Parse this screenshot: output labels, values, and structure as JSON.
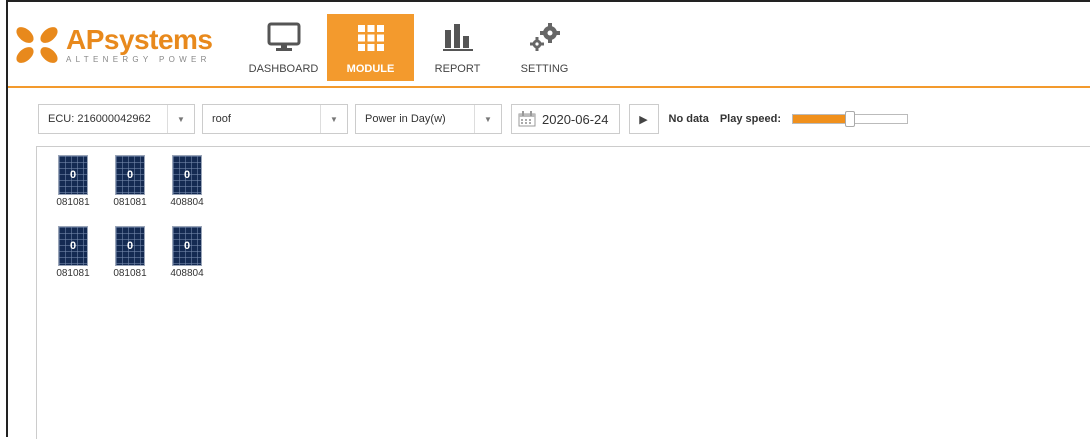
{
  "brand": {
    "name_ap": "AP",
    "name_rest": "systems",
    "tagline": "ALTENERGY POWER"
  },
  "nav": [
    {
      "label": "DASHBOARD",
      "icon": "monitor-icon",
      "active": false
    },
    {
      "label": "MODULE",
      "icon": "grid-icon",
      "active": true
    },
    {
      "label": "REPORT",
      "icon": "bar-chart-icon",
      "active": false
    },
    {
      "label": "SETTING",
      "icon": "gears-icon",
      "active": false
    }
  ],
  "toolbar": {
    "ecu_value": "ECU: 216000042962",
    "array_value": "roof",
    "metric_value": "Power in Day(w)",
    "date_value": "2020-06-24",
    "status_text": "No data",
    "speed_label": "Play speed:",
    "speed_level": 0.5
  },
  "modules": [
    {
      "value": "0",
      "id": "081081"
    },
    {
      "value": "0",
      "id": "081081"
    },
    {
      "value": "0",
      "id": "408804"
    },
    {
      "value": "0",
      "id": "081081"
    },
    {
      "value": "0",
      "id": "081081"
    },
    {
      "value": "0",
      "id": "408804"
    }
  ],
  "colors": {
    "accent": "#f39a2d",
    "panel": "#142a52"
  }
}
